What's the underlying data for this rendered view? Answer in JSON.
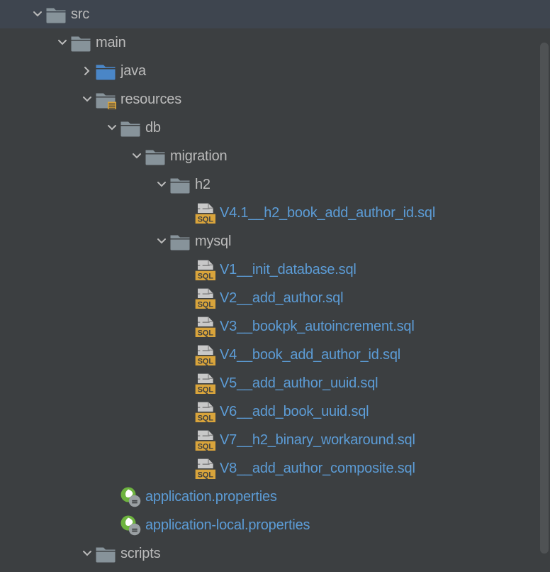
{
  "tree": {
    "src": "src",
    "main": "main",
    "java": "java",
    "resources": "resources",
    "db": "db",
    "migration": "migration",
    "h2": "h2",
    "h2_file": "V4.1__h2_book_add_author_id.sql",
    "mysql": "mysql",
    "mysql_files": [
      "V1__init_database.sql",
      "V2__add_author.sql",
      "V3__bookpk_autoincrement.sql",
      "V4__book_add_author_id.sql",
      "V5__add_author_uuid.sql",
      "V6__add_book_uuid.sql",
      "V7__h2_binary_workaround.sql",
      "V8__add_author_composite.sql"
    ],
    "app_props": "application.properties",
    "app_local_props": "application-local.properties",
    "scripts": "scripts"
  }
}
